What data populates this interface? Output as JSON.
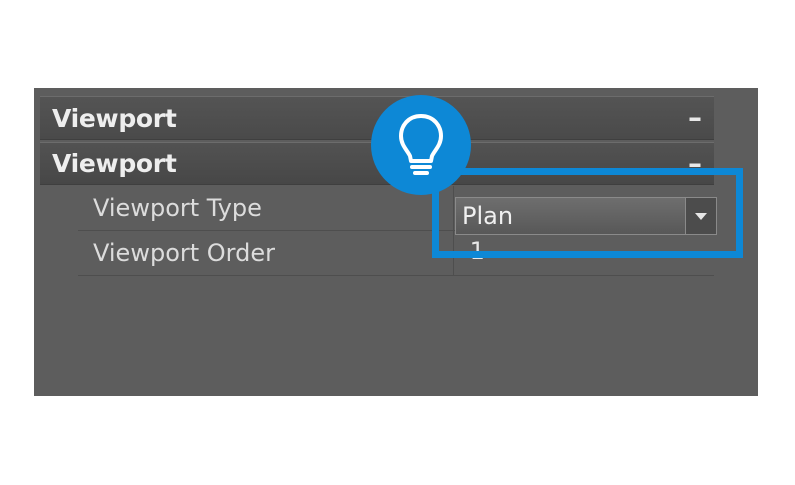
{
  "panel": {
    "sections": [
      {
        "title": "Viewport",
        "collapse_label": "–"
      },
      {
        "title": "Viewport",
        "collapse_label": "–"
      }
    ],
    "properties": [
      {
        "label": "Viewport Type",
        "value": "Plan"
      },
      {
        "label": "Viewport Order",
        "value": "-1"
      }
    ]
  },
  "icons": {
    "tip": "lightbulb-icon",
    "dropdown": "chevron-down-icon"
  },
  "colors": {
    "panel_bg": "#5d5d5d",
    "accent": "#0d88d6",
    "text": "#e8e8e8"
  }
}
